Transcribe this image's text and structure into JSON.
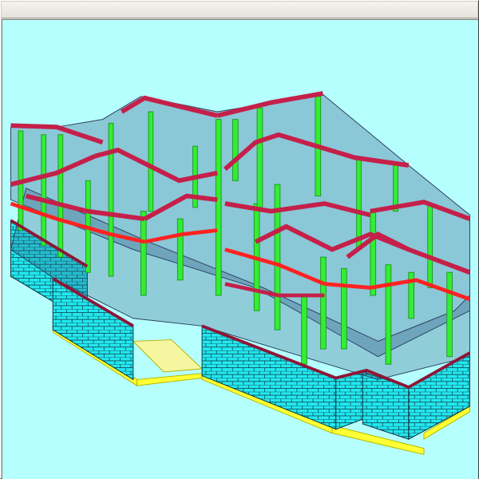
{
  "window": {
    "title": ""
  },
  "viewport": {
    "background_color": "#b6ffff",
    "colors": {
      "column": "#33ee33",
      "column_dark": "#1c9a1c",
      "beam": "#c4204a",
      "beam_dark": "#8e1636",
      "beam_highlight": "#ff2222",
      "slab": "#3a5f8c",
      "wall": "#22e8f0",
      "wall_mesh": "#0c2f3a",
      "footing": "#ffff33",
      "footing_dark": "#b4b400"
    }
  }
}
